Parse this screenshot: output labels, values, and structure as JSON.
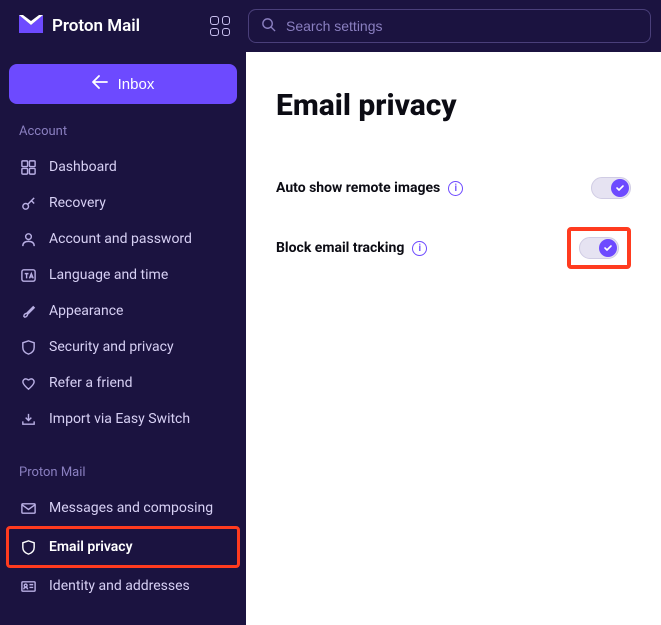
{
  "brand": {
    "name": "Proton Mail"
  },
  "search": {
    "placeholder": "Search settings"
  },
  "inboxButton": {
    "label": "Inbox"
  },
  "sections": {
    "account": {
      "label": "Account",
      "items": [
        {
          "label": "Dashboard"
        },
        {
          "label": "Recovery"
        },
        {
          "label": "Account and password"
        },
        {
          "label": "Language and time"
        },
        {
          "label": "Appearance"
        },
        {
          "label": "Security and privacy"
        },
        {
          "label": "Refer a friend"
        },
        {
          "label": "Import via Easy Switch"
        }
      ]
    },
    "protonmail": {
      "label": "Proton Mail",
      "items": [
        {
          "label": "Messages and composing"
        },
        {
          "label": "Email privacy"
        },
        {
          "label": "Identity and addresses"
        }
      ]
    }
  },
  "main": {
    "title": "Email privacy",
    "settings": [
      {
        "label": "Auto show remote images",
        "enabled": true
      },
      {
        "label": "Block email tracking",
        "enabled": true
      }
    ]
  },
  "infoGlyph": "i"
}
